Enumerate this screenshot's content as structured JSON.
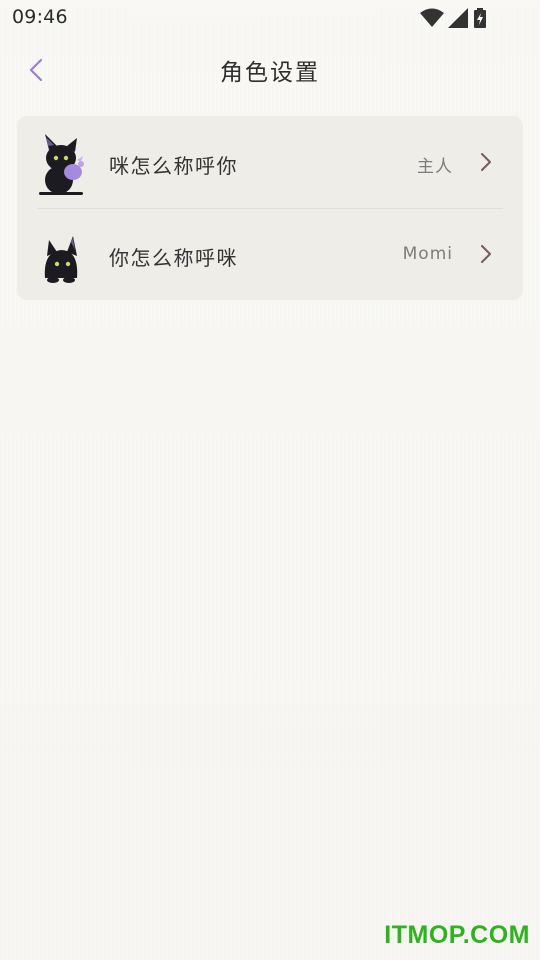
{
  "status_bar": {
    "time": "09:46",
    "icons": [
      "wifi-icon",
      "signal-icon",
      "battery-charging-icon"
    ]
  },
  "header": {
    "title": "角色设置",
    "back_icon": "chevron-left-icon"
  },
  "settings": [
    {
      "label": "咪怎么称呼你",
      "value": "主人",
      "avatar": "cat-with-toy-icon"
    },
    {
      "label": "你怎么称呼咪",
      "value": "Momi",
      "avatar": "cat-peeking-icon"
    }
  ],
  "colors": {
    "accent": "#9a7fd8",
    "card_bg": "#eeede8",
    "chevron": "#7a5a5a"
  },
  "watermark": "ITMOP.COM"
}
